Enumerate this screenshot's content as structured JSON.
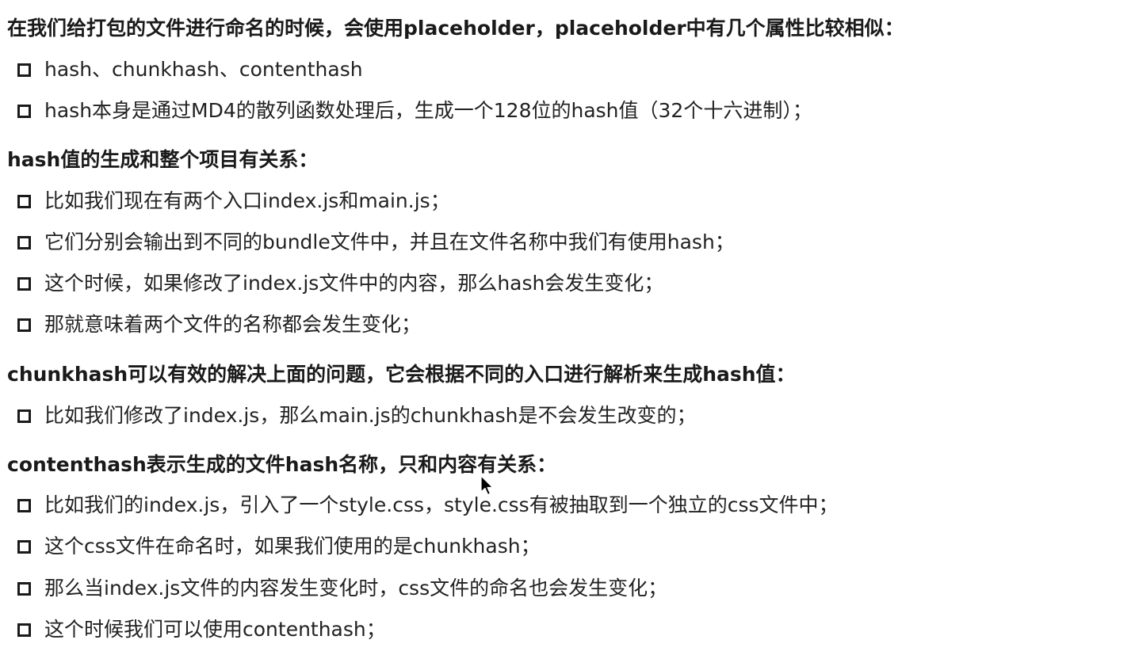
{
  "sections": [
    {
      "heading": "在我们给打包的文件进行命名的时候，会使用placeholder，placeholder中有几个属性比较相似：",
      "items": [
        "hash、chunkhash、contenthash",
        "hash本身是通过MD4的散列函数处理后，生成一个128位的hash值（32个十六进制）；"
      ]
    },
    {
      "heading": "hash值的生成和整个项目有关系：",
      "items": [
        "比如我们现在有两个入口index.js和main.js；",
        "它们分别会输出到不同的bundle文件中，并且在文件名称中我们有使用hash；",
        "这个时候，如果修改了index.js文件中的内容，那么hash会发生变化；",
        "那就意味着两个文件的名称都会发生变化；"
      ]
    },
    {
      "heading": "chunkhash可以有效的解决上面的问题，它会根据不同的入口进行解析来生成hash值：",
      "items": [
        "比如我们修改了index.js，那么main.js的chunkhash是不会发生改变的；"
      ]
    },
    {
      "heading": "contenthash表示生成的文件hash名称，只和内容有关系：",
      "items": [
        "比如我们的index.js，引入了一个style.css，style.css有被抽取到一个独立的css文件中；",
        "这个css文件在命名时，如果我们使用的是chunkhash；",
        "那么当index.js文件的内容发生变化时，css文件的命名也会发生变化；",
        "这个时候我们可以使用contenthash；"
      ]
    }
  ],
  "icons": {
    "bullet": "square-bullet-icon",
    "cursor": "mouse-pointer-icon"
  }
}
